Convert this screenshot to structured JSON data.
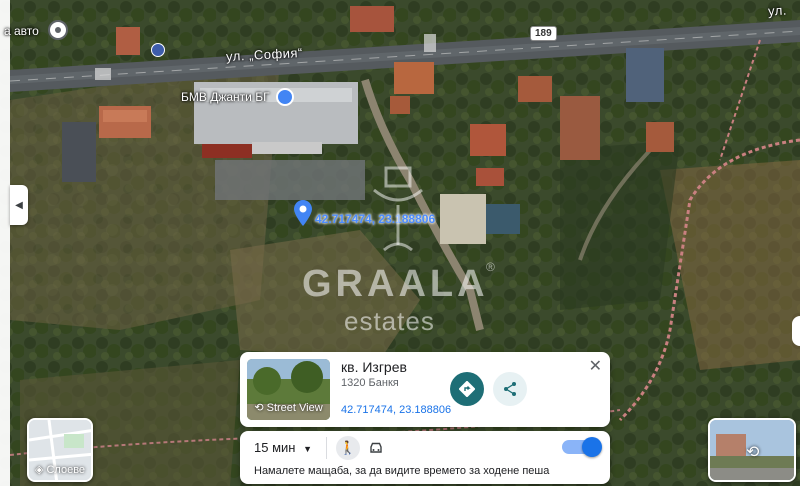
{
  "map": {
    "street_label": "ул. „София“",
    "top_right_label": "ул.",
    "poi_topleft": "а авто",
    "poi_shop": "БМВ Джанти БГ",
    "pin_coords": "42.717474, 23.188806",
    "road_number": "189"
  },
  "watermark": {
    "brand": "GRAALA",
    "sub": "estates",
    "reg": "®"
  },
  "place_card": {
    "title": "кв. Изгрев",
    "subtitle": "1320 Банкя",
    "coords": "42.717474, 23.188806",
    "thumb_label": "Street View"
  },
  "route_bar": {
    "time": "15 мин",
    "hint": "Намалете мащаба, за да видите времето за ходене пеша"
  },
  "layers": {
    "label": "Слоеве"
  },
  "colors": {
    "accent_teal": "#1e6e76",
    "link_blue": "#1a73e8"
  }
}
